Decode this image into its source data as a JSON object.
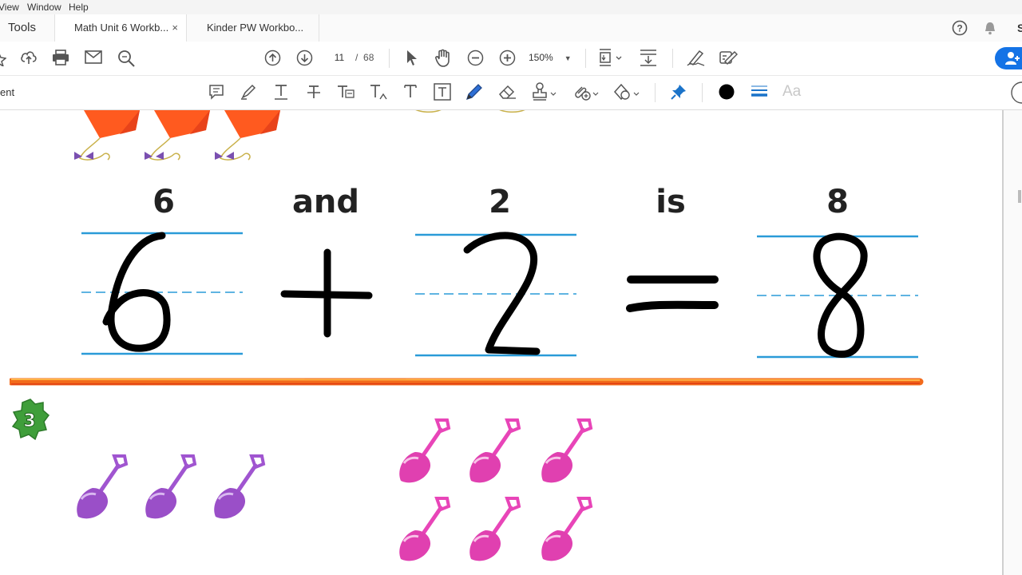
{
  "menu": {
    "items": [
      "View",
      "Window",
      "Help"
    ]
  },
  "tabs": {
    "home": "Tools",
    "items": [
      "Math Unit 6 Workb...",
      "Kinder PW Workbo..."
    ],
    "close": "×"
  },
  "header": {
    "user_initial": "S"
  },
  "navigation": {
    "current_page": "11",
    "page_separator": "/",
    "total_pages": "68",
    "zoom": "150%"
  },
  "comment_toolbar": {
    "label": "ent",
    "font_size_label": "Aa",
    "color": "#000000"
  },
  "icons": [
    "star-icon",
    "cloud-upload-icon",
    "print-icon",
    "mail-icon",
    "search-icon",
    "page-up-icon",
    "page-down-icon",
    "cursor-icon",
    "hand-icon",
    "zoom-out-icon",
    "zoom-in-icon",
    "fit-page-icon",
    "scroll-mode-icon",
    "sign-icon",
    "redact-icon",
    "help-icon",
    "bell-icon",
    "share-icon",
    "sticky-note-icon",
    "highlighter-icon",
    "text-underline-icon",
    "strikethrough-icon",
    "replace-text-icon",
    "insert-text-icon",
    "text-comment-icon",
    "text-box-icon",
    "pencil-icon",
    "eraser-icon",
    "stamp-icon",
    "attach-icon",
    "shapes-icon",
    "pin-icon",
    "color-swatch-icon",
    "line-weight-icon"
  ],
  "worksheet": {
    "words": [
      "6",
      "and",
      "2",
      "is",
      "8"
    ],
    "handwritten": [
      "6",
      "+",
      "2",
      "=",
      "8"
    ],
    "exercise_number": "3",
    "colors": {
      "guide_line": "#2a9bd8",
      "divider": "#f26a1b",
      "kite": "#ff5a1f",
      "shovel_purple": "#a055d0",
      "shovel_pink": "#e845b8",
      "badge": "#3f9e3a"
    }
  }
}
